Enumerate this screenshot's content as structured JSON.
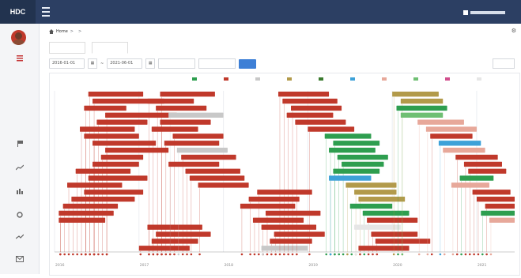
{
  "topbar": {
    "brand": "HDC",
    "user_name": ""
  },
  "sidebar": {
    "items": [
      {
        "label": "",
        "active": true
      },
      {
        "label": "",
        "active": false
      },
      {
        "label": "",
        "active": false
      },
      {
        "label": "",
        "active": false
      },
      {
        "label": "",
        "active": false
      },
      {
        "label": "",
        "active": false
      },
      {
        "label": "",
        "active": false
      },
      {
        "label": "",
        "active": false
      },
      {
        "label": "",
        "active": false
      },
      {
        "label": "",
        "active": false
      },
      {
        "label": "",
        "active": false
      }
    ]
  },
  "breadcrumb": {
    "home": "Home",
    "sep1": ">",
    "level1": "",
    "sep2": ">",
    "level2": ""
  },
  "tabs": [
    {
      "label": "",
      "active": false
    },
    {
      "label": "",
      "active": true
    }
  ],
  "filters": {
    "start_date": "2016-01-01",
    "separator": "~",
    "end_date": "2021-06-01",
    "select1": "",
    "select2": "",
    "search_label": "",
    "print_label": ""
  },
  "chart_data": {
    "type": "gantt",
    "legend": [
      {
        "label": "",
        "color": "#2e9e4f"
      },
      {
        "label": "",
        "color": "#c0392b"
      },
      {
        "label": "",
        "color": "#c8c8c8"
      },
      {
        "label": "",
        "color": "#b29a4a"
      },
      {
        "label": "",
        "color": "#3a7a2e"
      },
      {
        "label": "",
        "color": "#3da1d8"
      },
      {
        "label": "",
        "color": "#e7a89a"
      },
      {
        "label": "",
        "color": "#6fbf73"
      },
      {
        "label": "",
        "color": "#d14f8d"
      },
      {
        "label": "",
        "color": "#e6e6e6"
      }
    ],
    "x_axis": {
      "start_year": 2016,
      "end_year": 2021,
      "tick_labels": [
        "2016",
        "2017",
        "2018",
        "2019",
        "2020",
        "2021"
      ]
    },
    "tasks": [
      {
        "label": "",
        "start": 2016.4,
        "end": 2017.05,
        "color": "#c0392b"
      },
      {
        "label": "",
        "start": 2016.45,
        "end": 2017.3,
        "color": "#c0392b"
      },
      {
        "label": "",
        "start": 2016.35,
        "end": 2016.85,
        "color": "#c0392b"
      },
      {
        "label": "",
        "start": 2016.6,
        "end": 2017.45,
        "color": "#c0392b"
      },
      {
        "label": "",
        "start": 2016.5,
        "end": 2017.1,
        "color": "#c0392b"
      },
      {
        "label": "",
        "start": 2016.3,
        "end": 2016.95,
        "color": "#c0392b"
      },
      {
        "label": "",
        "start": 2016.35,
        "end": 2017.0,
        "color": "#c0392b"
      },
      {
        "label": "",
        "start": 2016.45,
        "end": 2017.2,
        "color": "#c0392b"
      },
      {
        "label": "",
        "start": 2016.6,
        "end": 2017.35,
        "color": "#c0392b"
      },
      {
        "label": "",
        "start": 2016.55,
        "end": 2017.05,
        "color": "#c0392b"
      },
      {
        "label": "",
        "start": 2016.45,
        "end": 2017.0,
        "color": "#c0392b"
      },
      {
        "label": "",
        "start": 2016.25,
        "end": 2016.9,
        "color": "#c0392b"
      },
      {
        "label": "",
        "start": 2016.4,
        "end": 2017.1,
        "color": "#c0392b"
      },
      {
        "label": "",
        "start": 2016.15,
        "end": 2016.8,
        "color": "#c0392b"
      },
      {
        "label": "",
        "start": 2016.35,
        "end": 2017.05,
        "color": "#c0392b"
      },
      {
        "label": "",
        "start": 2016.2,
        "end": 2016.95,
        "color": "#c0392b"
      },
      {
        "label": "",
        "start": 2016.1,
        "end": 2016.75,
        "color": "#c0392b"
      },
      {
        "label": "",
        "start": 2016.05,
        "end": 2016.7,
        "color": "#c0392b"
      },
      {
        "label": "",
        "start": 2016.05,
        "end": 2016.6,
        "color": "#c0392b"
      },
      {
        "label": "",
        "start": 2017.1,
        "end": 2017.75,
        "color": "#c0392b"
      },
      {
        "label": "",
        "start": 2017.2,
        "end": 2017.85,
        "color": "#c0392b"
      },
      {
        "label": "",
        "start": 2017.15,
        "end": 2017.7,
        "color": "#c0392b"
      },
      {
        "label": "",
        "start": 2017.0,
        "end": 2017.6,
        "color": "#c0392b"
      },
      {
        "label": "",
        "start": 2017.25,
        "end": 2017.9,
        "color": "#c0392b"
      },
      {
        "label": "",
        "start": 2017.1,
        "end": 2017.65,
        "color": "#c0392b"
      },
      {
        "label": "",
        "start": 2017.2,
        "end": 2017.8,
        "color": "#c0392b"
      },
      {
        "label": "",
        "start": 2017.35,
        "end": 2018.0,
        "color": "#c8c8c8"
      },
      {
        "label": "",
        "start": 2017.25,
        "end": 2017.85,
        "color": "#c0392b"
      },
      {
        "label": "",
        "start": 2017.15,
        "end": 2017.7,
        "color": "#c0392b"
      },
      {
        "label": "",
        "start": 2017.4,
        "end": 2018.0,
        "color": "#c0392b"
      },
      {
        "label": "",
        "start": 2017.3,
        "end": 2017.95,
        "color": "#c0392b"
      },
      {
        "label": "",
        "start": 2017.45,
        "end": 2018.05,
        "color": "#c8c8c8"
      },
      {
        "label": "",
        "start": 2017.5,
        "end": 2018.15,
        "color": "#c0392b"
      },
      {
        "label": "",
        "start": 2017.35,
        "end": 2017.95,
        "color": "#c0392b"
      },
      {
        "label": "",
        "start": 2017.55,
        "end": 2018.2,
        "color": "#c0392b"
      },
      {
        "label": "",
        "start": 2017.6,
        "end": 2018.25,
        "color": "#c0392b"
      },
      {
        "label": "",
        "start": 2017.7,
        "end": 2018.3,
        "color": "#c0392b"
      },
      {
        "label": "",
        "start": 2018.4,
        "end": 2019.05,
        "color": "#c0392b"
      },
      {
        "label": "",
        "start": 2018.3,
        "end": 2018.9,
        "color": "#c0392b"
      },
      {
        "label": "",
        "start": 2018.2,
        "end": 2018.85,
        "color": "#c0392b"
      },
      {
        "label": "",
        "start": 2018.5,
        "end": 2019.15,
        "color": "#c0392b"
      },
      {
        "label": "",
        "start": 2018.35,
        "end": 2018.95,
        "color": "#c0392b"
      },
      {
        "label": "",
        "start": 2018.45,
        "end": 2019.1,
        "color": "#c0392b"
      },
      {
        "label": "",
        "start": 2018.6,
        "end": 2019.2,
        "color": "#c0392b"
      },
      {
        "label": "",
        "start": 2018.55,
        "end": 2019.05,
        "color": "#c0392b"
      },
      {
        "label": "",
        "start": 2018.45,
        "end": 2019.0,
        "color": "#c8c8c8"
      },
      {
        "label": "",
        "start": 2018.65,
        "end": 2019.25,
        "color": "#c0392b"
      },
      {
        "label": "",
        "start": 2018.7,
        "end": 2019.35,
        "color": "#c0392b"
      },
      {
        "label": "",
        "start": 2018.8,
        "end": 2019.4,
        "color": "#c0392b"
      },
      {
        "label": "",
        "start": 2018.75,
        "end": 2019.3,
        "color": "#c0392b"
      },
      {
        "label": "",
        "start": 2018.85,
        "end": 2019.45,
        "color": "#c0392b"
      },
      {
        "label": "",
        "start": 2019.0,
        "end": 2019.55,
        "color": "#c0392b"
      },
      {
        "label": "",
        "start": 2019.2,
        "end": 2019.75,
        "color": "#2e9e4f"
      },
      {
        "label": "",
        "start": 2019.3,
        "end": 2019.85,
        "color": "#2e9e4f"
      },
      {
        "label": "",
        "start": 2019.25,
        "end": 2019.8,
        "color": "#2e9e4f"
      },
      {
        "label": "",
        "start": 2019.35,
        "end": 2019.95,
        "color": "#2e9e4f"
      },
      {
        "label": "",
        "start": 2019.4,
        "end": 2019.9,
        "color": "#2e9e4f"
      },
      {
        "label": "",
        "start": 2019.3,
        "end": 2019.85,
        "color": "#2e9e4f"
      },
      {
        "label": "",
        "start": 2019.25,
        "end": 2019.75,
        "color": "#3da1d8"
      },
      {
        "label": "",
        "start": 2019.45,
        "end": 2020.05,
        "color": "#b29a4a"
      },
      {
        "label": "",
        "start": 2019.55,
        "end": 2020.05,
        "color": "#b29a4a"
      },
      {
        "label": "",
        "start": 2019.6,
        "end": 2020.15,
        "color": "#b29a4a"
      },
      {
        "label": "",
        "start": 2019.5,
        "end": 2020.0,
        "color": "#2e9e4f"
      },
      {
        "label": "",
        "start": 2019.65,
        "end": 2020.2,
        "color": "#2e9e4f"
      },
      {
        "label": "",
        "start": 2019.7,
        "end": 2020.3,
        "color": "#c0392b"
      },
      {
        "label": "",
        "start": 2019.55,
        "end": 2020.1,
        "color": "#e6e6e6"
      },
      {
        "label": "",
        "start": 2019.75,
        "end": 2020.3,
        "color": "#c0392b"
      },
      {
        "label": "",
        "start": 2019.8,
        "end": 2020.45,
        "color": "#c0392b"
      },
      {
        "label": "",
        "start": 2019.6,
        "end": 2020.2,
        "color": "#c0392b"
      },
      {
        "label": "",
        "start": 2020.0,
        "end": 2020.55,
        "color": "#b29a4a"
      },
      {
        "label": "",
        "start": 2020.1,
        "end": 2020.6,
        "color": "#b29a4a"
      },
      {
        "label": "",
        "start": 2020.05,
        "end": 2020.65,
        "color": "#2e9e4f"
      },
      {
        "label": "",
        "start": 2020.1,
        "end": 2020.6,
        "color": "#6fbf73"
      },
      {
        "label": "",
        "start": 2020.3,
        "end": 2020.85,
        "color": "#e7a89a"
      },
      {
        "label": "",
        "start": 2020.4,
        "end": 2021.0,
        "color": "#e7a89a"
      },
      {
        "label": "",
        "start": 2020.45,
        "end": 2020.95,
        "color": "#c0392b"
      },
      {
        "label": "",
        "start": 2020.55,
        "end": 2021.05,
        "color": "#3da1d8"
      },
      {
        "label": "",
        "start": 2020.6,
        "end": 2021.1,
        "color": "#e7a89a"
      },
      {
        "label": "",
        "start": 2020.75,
        "end": 2021.25,
        "color": "#c0392b"
      },
      {
        "label": "",
        "start": 2020.85,
        "end": 2021.3,
        "color": "#c0392b"
      },
      {
        "label": "",
        "start": 2020.9,
        "end": 2021.35,
        "color": "#c0392b"
      },
      {
        "label": "",
        "start": 2020.8,
        "end": 2021.2,
        "color": "#2e9e4f"
      },
      {
        "label": "",
        "start": 2020.7,
        "end": 2021.15,
        "color": "#e7a89a"
      },
      {
        "label": "",
        "start": 2020.95,
        "end": 2021.4,
        "color": "#c0392b"
      },
      {
        "label": "",
        "start": 2021.0,
        "end": 2021.45,
        "color": "#c0392b"
      },
      {
        "label": "",
        "start": 2021.1,
        "end": 2021.45,
        "color": "#c0392b"
      },
      {
        "label": "",
        "start": 2021.05,
        "end": 2021.45,
        "color": "#2e9e4f"
      },
      {
        "label": "",
        "start": 2021.15,
        "end": 2021.45,
        "color": "#e7a89a"
      }
    ]
  }
}
